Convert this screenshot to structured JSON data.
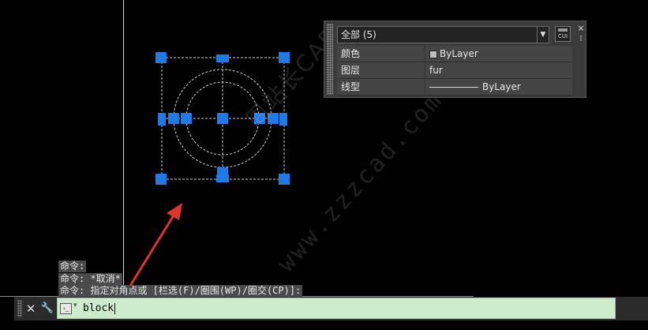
{
  "properties_palette": {
    "selection_label": "全部 (5)",
    "cui_label": "CUI",
    "close_glyph": "×",
    "pin_glyph": "⁝",
    "rows": [
      {
        "key": "颜色",
        "value": "ByLayer"
      },
      {
        "key": "图层",
        "value": "fur"
      },
      {
        "key": "线型",
        "value": "ByLayer"
      }
    ]
  },
  "watermark": {
    "line1": "周站长CAD",
    "line2": "www.zzzcad.com"
  },
  "command_history": [
    "命令:",
    "命令: *取消*",
    "命令: 指定对角点或 [栏选(F)/圈围(WP)/圈交(CP)]:"
  ],
  "command_line": {
    "input_value": "block",
    "close_glyph": "✕",
    "customize_glyph": "🔧",
    "prompt_glyph": "›_",
    "expand_glyph": "▲"
  },
  "colors": {
    "grip_blue": "#1e7be6",
    "arrow_red": "#e0352b",
    "command_input_bg": "#cdeccd"
  }
}
